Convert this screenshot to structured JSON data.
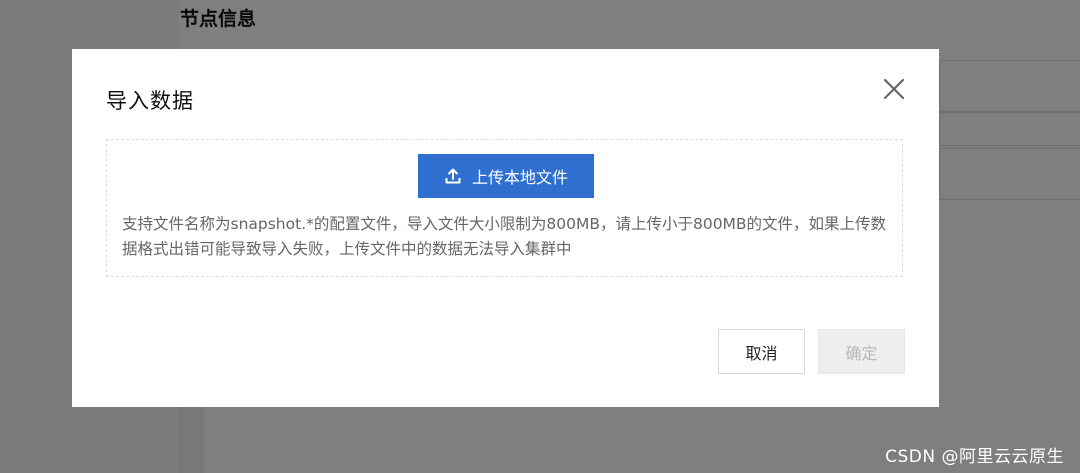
{
  "background": {
    "section_title": "节点信息"
  },
  "dialog": {
    "title": "导入数据",
    "close_icon": "close-icon",
    "upload_button_label": "上传本地文件",
    "upload_icon": "upload-icon",
    "hint_text": "支持文件名称为snapshot.*的配置文件，导入文件大小限制为800MB，请上传小于800MB的文件，如果上传数据格式出错可能导致导入失败，上传文件中的数据无法导入集群中",
    "cancel_label": "取消",
    "confirm_label": "确定"
  },
  "colors": {
    "primary": "#2f6fd0",
    "overlay": "rgba(0,0,0,0.5)",
    "disabled_text": "#b8b8b8"
  },
  "watermark": "CSDN @阿里云云原生"
}
